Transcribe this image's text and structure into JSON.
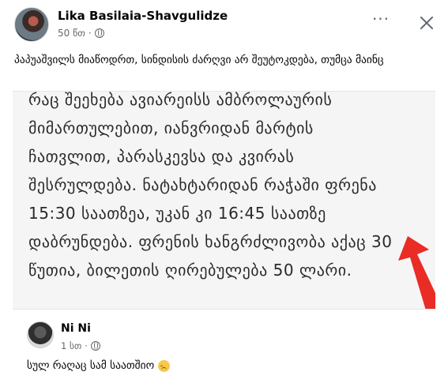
{
  "post": {
    "author": "Lika Basilaia-Shavgulidze",
    "time": "50 წთ",
    "separator": "·",
    "more_label": "···",
    "caption": "პაპუაშვილს მიაწოდრთ, სინდისის ძარღვი არ შეუტოკდება, თუმცა მაინც"
  },
  "photo": {
    "lines": [
      {
        "text": "რაც შეეხება ავიარეისს ამბროლაურის",
        "bold": false
      },
      {
        "text": "მიმართულებით, იანვრიდან მარტის",
        "bold": false
      },
      {
        "text": "ჩათვლით,   პარასკევსა და კვირას",
        "bold": false
      },
      {
        "text": "შესრულდება. ნატახტარიდან რაჭაში ფრენა",
        "bold": false
      },
      {
        "text": "15:30 საათზეა, უკან კი 16:45 საათზე",
        "bold": false
      },
      {
        "text": "დაბრუნდება. ფრენის ხანგრძლივობა აქაც 30",
        "bold": false
      },
      {
        "text": "წუთია, ბილეთის ღირებულება 50 ლარი.",
        "bold": false
      }
    ],
    "arrow_color": "#e8211a"
  },
  "comment": {
    "author": "Ni Ni",
    "time": "1 სთ",
    "separator": "·",
    "text": "სულ რაღაც სამ საათშიო"
  }
}
